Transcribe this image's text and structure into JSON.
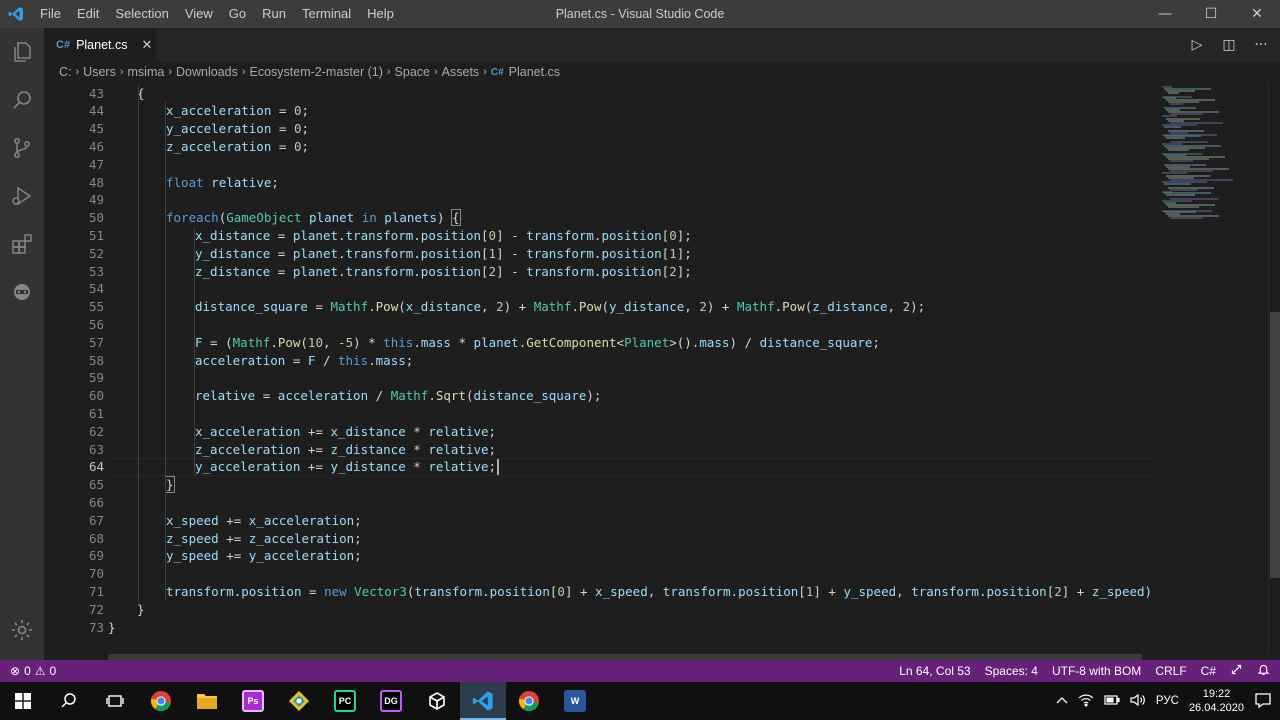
{
  "window": {
    "title": "Planet.cs - Visual Studio Code",
    "menu": [
      "File",
      "Edit",
      "Selection",
      "View",
      "Go",
      "Run",
      "Terminal",
      "Help"
    ],
    "controls": {
      "minimize": "—",
      "maximize": "☐",
      "close": "✕"
    }
  },
  "activitybar": [
    "explorer-icon",
    "search-icon",
    "source-control-icon",
    "run-debug-icon",
    "extensions-icon",
    "remote-icon",
    "gear-icon"
  ],
  "tab": {
    "icon_text": "C#",
    "label": "Planet.cs",
    "close": "✕"
  },
  "editor_actions": {
    "run": "▷",
    "split": "◫",
    "more": "···"
  },
  "breadcrumb": [
    "C:",
    "Users",
    "msima",
    "Downloads",
    "Ecosystem-2-master (1)",
    "Space",
    "Assets",
    "Planet.cs"
  ],
  "breadcrumb_sep": "›",
  "code": {
    "first_line_number": 43,
    "lines": [
      [
        {
          "t": "{",
          "c": "pl"
        }
      ],
      [
        {
          "t": "x_acceleration",
          "c": "va"
        },
        {
          "t": " = ",
          "c": "pl"
        },
        {
          "t": "0",
          "c": "nu"
        },
        {
          "t": ";",
          "c": "pl"
        }
      ],
      [
        {
          "t": "y_acceleration",
          "c": "va"
        },
        {
          "t": " = ",
          "c": "pl"
        },
        {
          "t": "0",
          "c": "nu"
        },
        {
          "t": ";",
          "c": "pl"
        }
      ],
      [
        {
          "t": "z_acceleration",
          "c": "va"
        },
        {
          "t": " = ",
          "c": "pl"
        },
        {
          "t": "0",
          "c": "nu"
        },
        {
          "t": ";",
          "c": "pl"
        }
      ],
      [],
      [
        {
          "t": "float",
          "c": "kw"
        },
        {
          "t": " ",
          "c": "pl"
        },
        {
          "t": "relative",
          "c": "va"
        },
        {
          "t": ";",
          "c": "pl"
        }
      ],
      [],
      [
        {
          "t": "foreach",
          "c": "kw"
        },
        {
          "t": "(",
          "c": "pl"
        },
        {
          "t": "GameObject",
          "c": "ty"
        },
        {
          "t": " ",
          "c": "pl"
        },
        {
          "t": "planet",
          "c": "va"
        },
        {
          "t": " ",
          "c": "pl"
        },
        {
          "t": "in",
          "c": "kw"
        },
        {
          "t": " ",
          "c": "pl"
        },
        {
          "t": "planets",
          "c": "va"
        },
        {
          "t": ") ",
          "c": "pl"
        },
        {
          "t": "{",
          "c": "pl br"
        }
      ],
      [
        {
          "t": "x_distance",
          "c": "va"
        },
        {
          "t": " = ",
          "c": "pl"
        },
        {
          "t": "planet",
          "c": "va"
        },
        {
          "t": ".",
          "c": "pl"
        },
        {
          "t": "transform",
          "c": "va"
        },
        {
          "t": ".",
          "c": "pl"
        },
        {
          "t": "position",
          "c": "va"
        },
        {
          "t": "[",
          "c": "pl"
        },
        {
          "t": "0",
          "c": "nu"
        },
        {
          "t": "] - ",
          "c": "pl"
        },
        {
          "t": "transform",
          "c": "va"
        },
        {
          "t": ".",
          "c": "pl"
        },
        {
          "t": "position",
          "c": "va"
        },
        {
          "t": "[",
          "c": "pl"
        },
        {
          "t": "0",
          "c": "nu"
        },
        {
          "t": "];",
          "c": "pl"
        }
      ],
      [
        {
          "t": "y_distance",
          "c": "va"
        },
        {
          "t": " = ",
          "c": "pl"
        },
        {
          "t": "planet",
          "c": "va"
        },
        {
          "t": ".",
          "c": "pl"
        },
        {
          "t": "transform",
          "c": "va"
        },
        {
          "t": ".",
          "c": "pl"
        },
        {
          "t": "position",
          "c": "va"
        },
        {
          "t": "[",
          "c": "pl"
        },
        {
          "t": "1",
          "c": "nu"
        },
        {
          "t": "] - ",
          "c": "pl"
        },
        {
          "t": "transform",
          "c": "va"
        },
        {
          "t": ".",
          "c": "pl"
        },
        {
          "t": "position",
          "c": "va"
        },
        {
          "t": "[",
          "c": "pl"
        },
        {
          "t": "1",
          "c": "nu"
        },
        {
          "t": "];",
          "c": "pl"
        }
      ],
      [
        {
          "t": "z_distance",
          "c": "va"
        },
        {
          "t": " = ",
          "c": "pl"
        },
        {
          "t": "planet",
          "c": "va"
        },
        {
          "t": ".",
          "c": "pl"
        },
        {
          "t": "transform",
          "c": "va"
        },
        {
          "t": ".",
          "c": "pl"
        },
        {
          "t": "position",
          "c": "va"
        },
        {
          "t": "[",
          "c": "pl"
        },
        {
          "t": "2",
          "c": "nu"
        },
        {
          "t": "] - ",
          "c": "pl"
        },
        {
          "t": "transform",
          "c": "va"
        },
        {
          "t": ".",
          "c": "pl"
        },
        {
          "t": "position",
          "c": "va"
        },
        {
          "t": "[",
          "c": "pl"
        },
        {
          "t": "2",
          "c": "nu"
        },
        {
          "t": "];",
          "c": "pl"
        }
      ],
      [],
      [
        {
          "t": "distance_square",
          "c": "va"
        },
        {
          "t": " = ",
          "c": "pl"
        },
        {
          "t": "Mathf",
          "c": "ty"
        },
        {
          "t": ".",
          "c": "pl"
        },
        {
          "t": "Pow",
          "c": "fn"
        },
        {
          "t": "(",
          "c": "pl"
        },
        {
          "t": "x_distance",
          "c": "va"
        },
        {
          "t": ", ",
          "c": "pl"
        },
        {
          "t": "2",
          "c": "nu"
        },
        {
          "t": ") + ",
          "c": "pl"
        },
        {
          "t": "Mathf",
          "c": "ty"
        },
        {
          "t": ".",
          "c": "pl"
        },
        {
          "t": "Pow",
          "c": "fn"
        },
        {
          "t": "(",
          "c": "pl"
        },
        {
          "t": "y_distance",
          "c": "va"
        },
        {
          "t": ", ",
          "c": "pl"
        },
        {
          "t": "2",
          "c": "nu"
        },
        {
          "t": ") + ",
          "c": "pl"
        },
        {
          "t": "Mathf",
          "c": "ty"
        },
        {
          "t": ".",
          "c": "pl"
        },
        {
          "t": "Pow",
          "c": "fn"
        },
        {
          "t": "(",
          "c": "pl"
        },
        {
          "t": "z_distance",
          "c": "va"
        },
        {
          "t": ", ",
          "c": "pl"
        },
        {
          "t": "2",
          "c": "nu"
        },
        {
          "t": ");",
          "c": "pl"
        }
      ],
      [],
      [
        {
          "t": "F",
          "c": "va"
        },
        {
          "t": " = (",
          "c": "pl"
        },
        {
          "t": "Mathf",
          "c": "ty"
        },
        {
          "t": ".",
          "c": "pl"
        },
        {
          "t": "Pow",
          "c": "fn"
        },
        {
          "t": "(",
          "c": "pl"
        },
        {
          "t": "10",
          "c": "nu"
        },
        {
          "t": ", ",
          "c": "pl"
        },
        {
          "t": "-5",
          "c": "nu"
        },
        {
          "t": ") * ",
          "c": "pl"
        },
        {
          "t": "this",
          "c": "kw"
        },
        {
          "t": ".",
          "c": "pl"
        },
        {
          "t": "mass",
          "c": "va"
        },
        {
          "t": " * ",
          "c": "pl"
        },
        {
          "t": "planet",
          "c": "va"
        },
        {
          "t": ".",
          "c": "pl"
        },
        {
          "t": "GetComponent",
          "c": "fn"
        },
        {
          "t": "<",
          "c": "pl"
        },
        {
          "t": "Planet",
          "c": "ty"
        },
        {
          "t": ">().",
          "c": "pl"
        },
        {
          "t": "mass",
          "c": "va"
        },
        {
          "t": ") / ",
          "c": "pl"
        },
        {
          "t": "distance_square",
          "c": "va"
        },
        {
          "t": ";",
          "c": "pl"
        }
      ],
      [
        {
          "t": "acceleration",
          "c": "va"
        },
        {
          "t": " = ",
          "c": "pl"
        },
        {
          "t": "F",
          "c": "va"
        },
        {
          "t": " / ",
          "c": "pl"
        },
        {
          "t": "this",
          "c": "kw"
        },
        {
          "t": ".",
          "c": "pl"
        },
        {
          "t": "mass",
          "c": "va"
        },
        {
          "t": ";",
          "c": "pl"
        }
      ],
      [],
      [
        {
          "t": "relative",
          "c": "va"
        },
        {
          "t": " = ",
          "c": "pl"
        },
        {
          "t": "acceleration",
          "c": "va"
        },
        {
          "t": " / ",
          "c": "pl"
        },
        {
          "t": "Mathf",
          "c": "ty"
        },
        {
          "t": ".",
          "c": "pl"
        },
        {
          "t": "Sqrt",
          "c": "fn"
        },
        {
          "t": "(",
          "c": "pl"
        },
        {
          "t": "distance_square",
          "c": "va"
        },
        {
          "t": ");",
          "c": "pl"
        }
      ],
      [],
      [
        {
          "t": "x_acceleration",
          "c": "va"
        },
        {
          "t": " += ",
          "c": "pl"
        },
        {
          "t": "x_distance",
          "c": "va"
        },
        {
          "t": " * ",
          "c": "pl"
        },
        {
          "t": "relative",
          "c": "va"
        },
        {
          "t": ";",
          "c": "pl"
        }
      ],
      [
        {
          "t": "z_acceleration",
          "c": "va"
        },
        {
          "t": " += ",
          "c": "pl"
        },
        {
          "t": "z_distance",
          "c": "va"
        },
        {
          "t": " * ",
          "c": "pl"
        },
        {
          "t": "relative",
          "c": "va"
        },
        {
          "t": ";",
          "c": "pl"
        }
      ],
      [
        {
          "t": "y_acceleration",
          "c": "va"
        },
        {
          "t": " += ",
          "c": "pl"
        },
        {
          "t": "y_distance",
          "c": "va"
        },
        {
          "t": " * ",
          "c": "pl"
        },
        {
          "t": "relative",
          "c": "va"
        },
        {
          "t": ";",
          "c": "pl"
        }
      ],
      [
        {
          "t": "}",
          "c": "pl br"
        }
      ],
      [],
      [
        {
          "t": "x_speed",
          "c": "va"
        },
        {
          "t": " += ",
          "c": "pl"
        },
        {
          "t": "x_acceleration",
          "c": "va"
        },
        {
          "t": ";",
          "c": "pl"
        }
      ],
      [
        {
          "t": "z_speed",
          "c": "va"
        },
        {
          "t": " += ",
          "c": "pl"
        },
        {
          "t": "z_acceleration",
          "c": "va"
        },
        {
          "t": ";",
          "c": "pl"
        }
      ],
      [
        {
          "t": "y_speed",
          "c": "va"
        },
        {
          "t": " += ",
          "c": "pl"
        },
        {
          "t": "y_acceleration",
          "c": "va"
        },
        {
          "t": ";",
          "c": "pl"
        }
      ],
      [],
      [
        {
          "t": "transform",
          "c": "va"
        },
        {
          "t": ".",
          "c": "pl"
        },
        {
          "t": "position",
          "c": "va"
        },
        {
          "t": " = ",
          "c": "pl"
        },
        {
          "t": "new",
          "c": "kw"
        },
        {
          "t": " ",
          "c": "pl"
        },
        {
          "t": "Vector3",
          "c": "ty"
        },
        {
          "t": "(",
          "c": "pl"
        },
        {
          "t": "transform",
          "c": "va"
        },
        {
          "t": ".",
          "c": "pl"
        },
        {
          "t": "position",
          "c": "va"
        },
        {
          "t": "[",
          "c": "pl"
        },
        {
          "t": "0",
          "c": "nu"
        },
        {
          "t": "] + ",
          "c": "pl"
        },
        {
          "t": "x_speed",
          "c": "va"
        },
        {
          "t": ", ",
          "c": "pl"
        },
        {
          "t": "transform",
          "c": "va"
        },
        {
          "t": ".",
          "c": "pl"
        },
        {
          "t": "position",
          "c": "va"
        },
        {
          "t": "[",
          "c": "pl"
        },
        {
          "t": "1",
          "c": "nu"
        },
        {
          "t": "] + ",
          "c": "pl"
        },
        {
          "t": "y_speed",
          "c": "va"
        },
        {
          "t": ", ",
          "c": "pl"
        },
        {
          "t": "transform",
          "c": "va"
        },
        {
          "t": ".",
          "c": "pl"
        },
        {
          "t": "position",
          "c": "va"
        },
        {
          "t": "[",
          "c": "pl"
        },
        {
          "t": "2",
          "c": "nu"
        },
        {
          "t": "] + ",
          "c": "pl"
        },
        {
          "t": "z_speed",
          "c": "va"
        },
        {
          "t": ");",
          "c": "pl"
        }
      ],
      [
        {
          "t": "}",
          "c": "pl"
        }
      ],
      [
        {
          "t": "}",
          "c": "pl"
        }
      ]
    ],
    "indent_levels": [
      1,
      2,
      2,
      2,
      0,
      2,
      0,
      2,
      3,
      3,
      3,
      0,
      3,
      0,
      3,
      3,
      0,
      3,
      0,
      3,
      3,
      3,
      2,
      0,
      2,
      2,
      2,
      0,
      2,
      1,
      0
    ],
    "active_line": 64
  },
  "statusbar": {
    "errors": "0",
    "warnings": "0",
    "position": "Ln 64, Col 53",
    "spaces": "Spaces: 4",
    "encoding": "UTF-8 with BOM",
    "eol": "CRLF",
    "language": "C#",
    "color": "#68217a"
  },
  "taskbar": {
    "apps": [
      "chrome-icon",
      "folder-icon",
      "photoshop-icon",
      "git-kraken-icon",
      "pycharm-icon",
      "datagrip-icon",
      "unity-icon",
      "vscode-icon",
      "chrome-icon",
      "word-icon"
    ],
    "app_labels": {
      "photoshop": "Ps",
      "pycharm": "PC",
      "datagrip": "DG",
      "word": "W"
    },
    "lang": "РУС",
    "time": "19:22",
    "date": "26.04.2020"
  }
}
